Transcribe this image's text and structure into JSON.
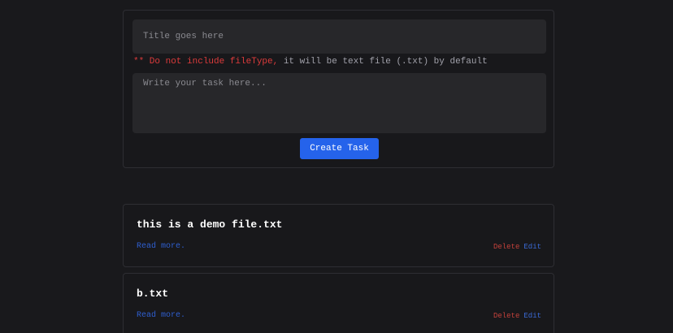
{
  "form": {
    "title_placeholder": "Title goes here",
    "title_value": "",
    "hint_warning": "** Do not include fileType,",
    "hint_rest": " it will be text file (.txt) by default",
    "task_placeholder": "Write your task here...",
    "task_value": "",
    "create_label": "Create Task"
  },
  "tasks": [
    {
      "title": "this is a demo file.txt",
      "read_more": "Read more.",
      "delete_label": "Delete",
      "edit_label": "Edit"
    },
    {
      "title": "b.txt",
      "read_more": "Read more.",
      "delete_label": "Delete",
      "edit_label": "Edit"
    }
  ],
  "colors": {
    "background": "#19191c",
    "input_bg": "#27272a",
    "primary_button": "#2563eb",
    "warning_text": "#dc3b3b",
    "delete_text": "#c2413a",
    "link_text": "#2f5fd0"
  }
}
